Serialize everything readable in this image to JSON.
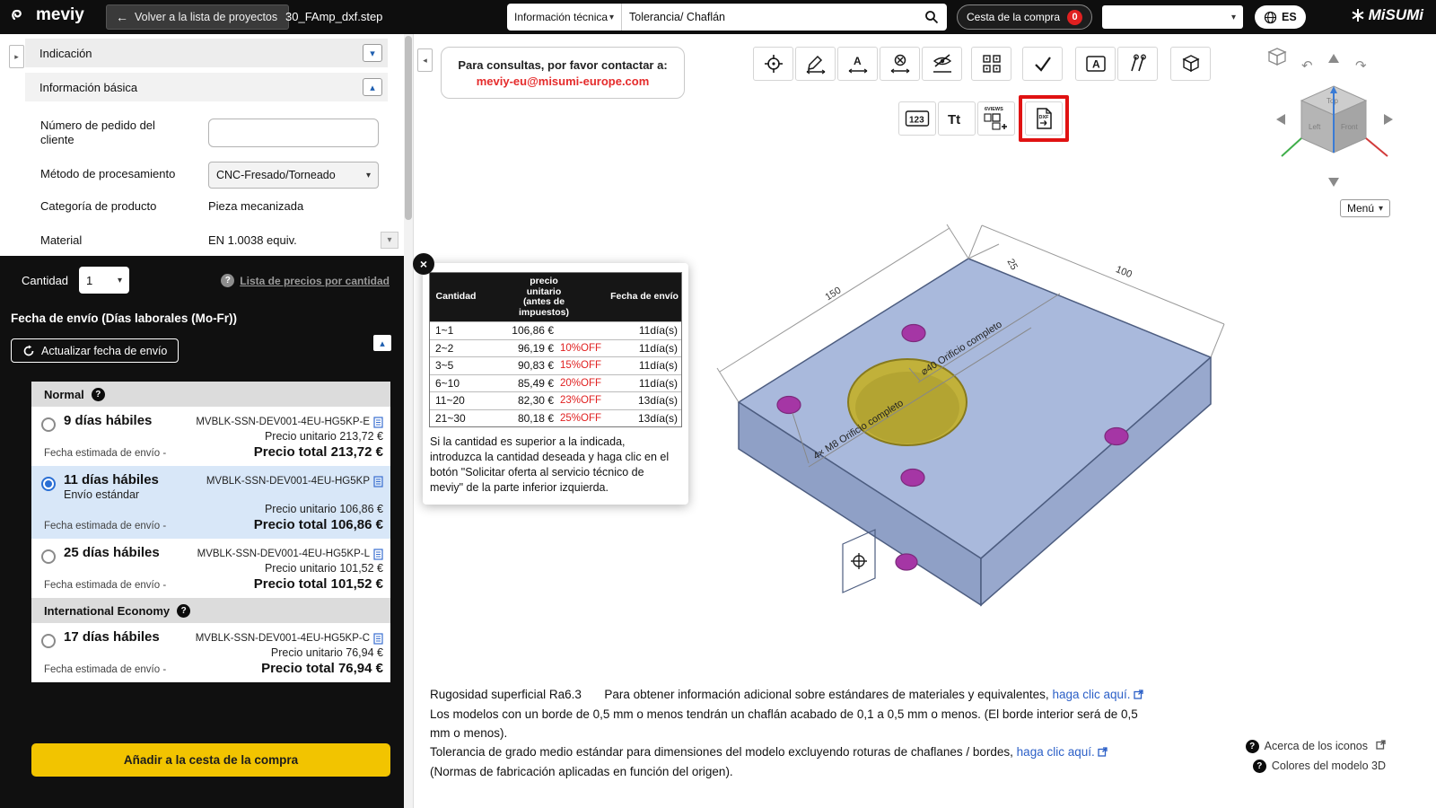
{
  "topbar": {
    "logo_text": "meviy",
    "back_button": "Volver a la lista de proyectos",
    "filename": "30_FAmp_dxf.step",
    "search_category": "Información técnica",
    "search_value": "Tolerancia/ Chaflán",
    "cart_label": "Cesta de la compra",
    "cart_count": "0",
    "lang": "ES",
    "brand": "MiSUMi"
  },
  "sidebar": {
    "indication": "Indicación",
    "basic_info": "Información básica",
    "customer_order_label": "Número de pedido del cliente",
    "processing_label": "Método de procesamiento",
    "processing_value": "CNC-Fresado/Torneado",
    "category_label": "Categoría de producto",
    "category_value": "Pieza mecanizada",
    "material_label": "Material",
    "material_value": "EN 1.0038 equiv.",
    "quantity_label": "Cantidad",
    "quantity_value": "1",
    "price_list_link": "Lista de precios por cantidad",
    "shipping_title": "Fecha de envío (Días laborales (Mo-Fr))",
    "update_button": "Actualizar fecha de envío",
    "normal_header": "Normal",
    "intl_header": "International Economy",
    "options": [
      {
        "days": "9 días hábiles",
        "sub": "",
        "code": "MVBLK-SSN-DEV001-4EU-HG5KP-E",
        "unit": "Precio unitario 213,72 €",
        "est": "Fecha estimada de envío -",
        "total": "Precio total 213,72 €"
      },
      {
        "days": "11 días hábiles",
        "sub": "Envío estándar",
        "code": "MVBLK-SSN-DEV001-4EU-HG5KP",
        "unit": "Precio unitario 106,86 €",
        "est": "Fecha estimada de envío -",
        "total": "Precio total 106,86 €"
      },
      {
        "days": "25 días hábiles",
        "sub": "",
        "code": "MVBLK-SSN-DEV001-4EU-HG5KP-L",
        "unit": "Precio unitario 101,52 €",
        "est": "Fecha estimada de envío -",
        "total": "Precio total 101,52 €"
      },
      {
        "days": "17 días hábiles",
        "sub": "",
        "code": "MVBLK-SSN-DEV001-4EU-HG5KP-C",
        "unit": "Precio unitario 76,94 €",
        "est": "Fecha estimada de envío -",
        "total": "Precio total 76,94 €"
      }
    ],
    "add_to_cart": "Añadir a la cesta de la compra"
  },
  "main": {
    "contact_line": "Para consultas, por favor contactar a:",
    "contact_email": "meviy-eu@misumi-europe.com",
    "toolbar2": {
      "t123": "123",
      "tt": "Tt",
      "views": "6VIEWS",
      "dxf": "DXF"
    },
    "menu_button": "Menú",
    "cube": {
      "top": "Top",
      "front": "Front",
      "left": "Left"
    }
  },
  "price_popup": {
    "col_qty": "Cantidad",
    "col_price": "precio unitario (antes de impuestos)",
    "col_ship": "Fecha de envío",
    "rows": [
      {
        "qty": "1~1",
        "price": "106,86 €",
        "off": "",
        "days": "11día(s)"
      },
      {
        "qty": "2~2",
        "price": "96,19 €",
        "off": "10%OFF",
        "days": "11día(s)"
      },
      {
        "qty": "3~5",
        "price": "90,83 €",
        "off": "15%OFF",
        "days": "11día(s)"
      },
      {
        "qty": "6~10",
        "price": "85,49 €",
        "off": "20%OFF",
        "days": "11día(s)"
      },
      {
        "qty": "11~20",
        "price": "82,30 €",
        "off": "23%OFF",
        "days": "13día(s)"
      },
      {
        "qty": "21~30",
        "price": "80,18 €",
        "off": "25%OFF",
        "days": "13día(s)"
      }
    ],
    "note": "Si la cantidad es superior a la indicada, introduzca la cantidad deseada y haga clic en el botón \"Solicitar oferta al servicio técnico de meviy\" de la parte inferior izquierda."
  },
  "viewer": {
    "dim_150": "150",
    "dim_25": "25",
    "dim_100": "100",
    "ann_hole": "⌀40  Orificio completo",
    "ann_m8": "4× M8  Orificio completo"
  },
  "footer": {
    "line1a": "Rugosidad superficial Ra6.3",
    "line1b": "Para obtener información adicional sobre estándares de materiales y equivalentes,",
    "line1_link": "haga clic aquí.",
    "line2": "Los modelos con un borde de 0,5 mm o menos tendrán un chaflán acabado de 0,1 a 0,5 mm o menos. (El borde interior será de 0,5 mm o menos).",
    "line3": "Tolerancia de grado medio estándar para dimensiones del modelo excluyendo roturas de chaflanes / bordes,",
    "line3_link": "haga clic aquí.",
    "line4": "(Normas de fabricación aplicadas en función del origen).",
    "about_icons": "Acerca de los iconos",
    "model_colors": "Colores del modelo 3D"
  },
  "colors": {
    "accent_yellow": "#f2c400",
    "selected_blue": "#d8e7f8",
    "discount_red": "#e02020",
    "link_blue": "#2b5fc7",
    "model_plate": "#a9b9dc",
    "model_hole": "#c1b13a",
    "model_counterbore": "#a536a5",
    "highlight_red": "#e01212"
  }
}
